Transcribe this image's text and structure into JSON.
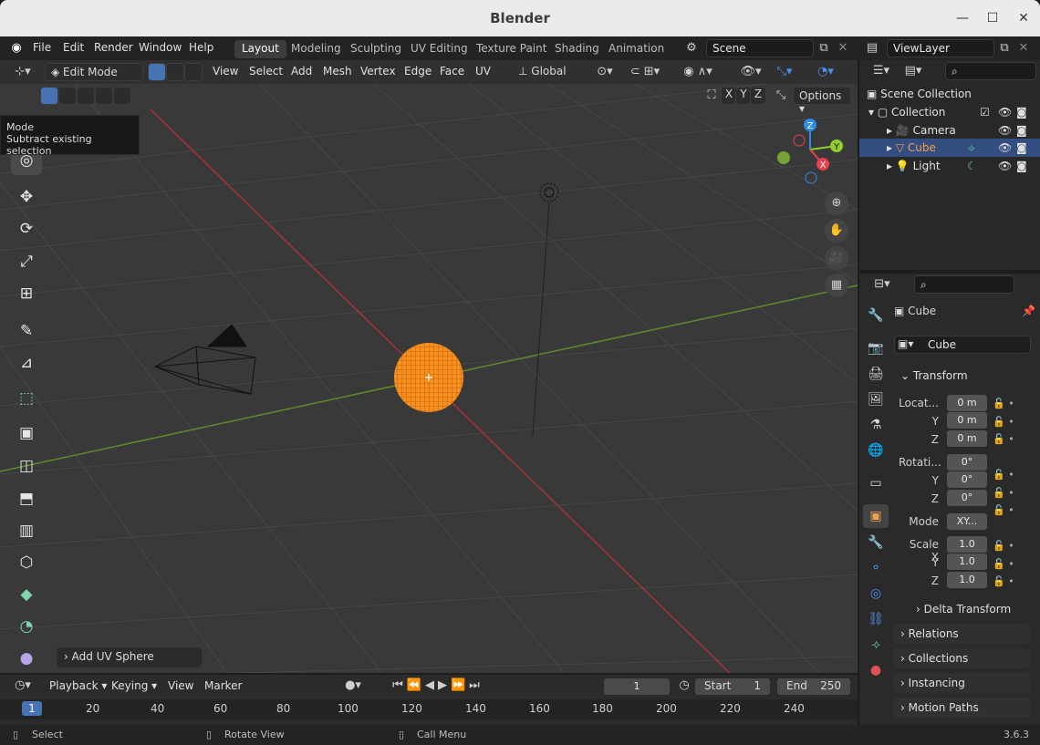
{
  "window": {
    "title": "Blender",
    "btn_min": "—",
    "btn_max": "☐",
    "btn_close": "✕"
  },
  "menus": [
    "File",
    "Edit",
    "Render",
    "Window",
    "Help"
  ],
  "workspaces": [
    "Layout",
    "Modeling",
    "Sculpting",
    "UV Editing",
    "Texture Paint",
    "Shading",
    "Animation"
  ],
  "scene": {
    "value": "Scene"
  },
  "viewlayer": {
    "value": "ViewLayer"
  },
  "viewport_header": {
    "mode": "Edit Mode",
    "menus": [
      "View",
      "Select",
      "Add",
      "Mesh",
      "Vertex",
      "Edge",
      "Face",
      "UV"
    ],
    "orientation": "Global",
    "options_label": "Options",
    "axes": [
      "X",
      "Y",
      "Z"
    ]
  },
  "tooltip": {
    "title": "Mode",
    "body": "Subtract existing selection"
  },
  "gizmo": {
    "x": "X",
    "y": "Y",
    "z": "Z"
  },
  "last_operator": "Add UV Sphere",
  "outliner": {
    "root": "Scene Collection",
    "collection": "Collection",
    "items": [
      {
        "label": "Camera"
      },
      {
        "label": "Cube",
        "selected": true
      },
      {
        "label": "Light"
      }
    ]
  },
  "properties": {
    "object_name": "Cube",
    "data_name": "Cube",
    "transform_label": "Transform",
    "location_label": "Locat...",
    "rotation_label": "Rotati...",
    "y_label": "Y",
    "z_label": "Z",
    "location": [
      "0 m",
      "0 m",
      "0 m"
    ],
    "rotation": [
      "0°",
      "0°",
      "0°"
    ],
    "mode_label": "Mode",
    "mode_value": "XY...",
    "scale_label": "Scale X",
    "scale": [
      "1.0",
      "1.0",
      "1.0"
    ],
    "panels": [
      "Delta Transform",
      "Relations",
      "Collections",
      "Instancing",
      "Motion Paths"
    ]
  },
  "timeline": {
    "menus": [
      "Playback",
      "Keying",
      "View",
      "Marker"
    ],
    "current_frame": "1",
    "start_label": "Start",
    "start": "1",
    "end_label": "End",
    "end": "250",
    "ruler": [
      "1",
      "20",
      "40",
      "60",
      "80",
      "100",
      "120",
      "140",
      "160",
      "180",
      "200",
      "220",
      "240"
    ]
  },
  "status": {
    "select": "Select",
    "rotate": "Rotate View",
    "menu": "Call Menu",
    "version": "3.6.3"
  },
  "colors": {
    "selected": "#f47a1c",
    "accent": "#4772b3",
    "x_axis": "#e8414e",
    "y_axis": "#8ecf2f",
    "z_axis": "#2d8ceb"
  }
}
